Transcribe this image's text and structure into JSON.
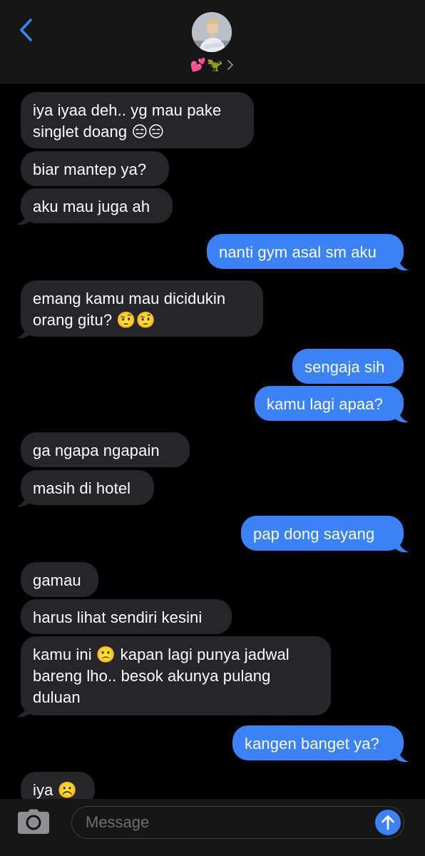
{
  "header": {
    "contact_name": "💕🦖",
    "accent": "#3B82F6"
  },
  "messages": [
    {
      "dir": "in",
      "text": "iya iyaa deh.. yg mau pake\nsinglet doang 😑😑",
      "tail": false
    },
    {
      "dir": "in",
      "text": "biar mantep ya?",
      "tail": false
    },
    {
      "dir": "in",
      "text": "aku mau juga ah",
      "tail": true
    },
    {
      "dir": "out",
      "text": "nanti gym asal sm aku",
      "tail": true
    },
    {
      "dir": "in",
      "text": "emang kamu mau dicidukin\norang gitu? 🤨🤨",
      "tail": true
    },
    {
      "dir": "out",
      "text": "sengaja sih",
      "tail": false
    },
    {
      "dir": "out",
      "text": "kamu lagi apaa?",
      "tail": true
    },
    {
      "dir": "in",
      "text": "ga ngapa ngapain",
      "tail": false
    },
    {
      "dir": "in",
      "text": "masih di hotel",
      "tail": true
    },
    {
      "dir": "out",
      "text": "pap dong sayang",
      "tail": true
    },
    {
      "dir": "in",
      "text": "gamau",
      "tail": false
    },
    {
      "dir": "in",
      "text": "harus lihat sendiri kesini",
      "tail": false
    },
    {
      "dir": "in",
      "text": "kamu ini 🙁 kapan lagi punya jadwal\nbareng lho.. besok akunya pulang\nduluan",
      "tail": true
    },
    {
      "dir": "out",
      "text": "kangen banget ya?",
      "tail": true
    },
    {
      "dir": "in",
      "text": "iya ☹️",
      "tail": true
    }
  ],
  "input": {
    "placeholder": "Message"
  },
  "colors": {
    "incoming_bubble": "#26252A",
    "outgoing_bubble": "#3B82F6",
    "header_bg": "#161616",
    "background": "#000000"
  }
}
